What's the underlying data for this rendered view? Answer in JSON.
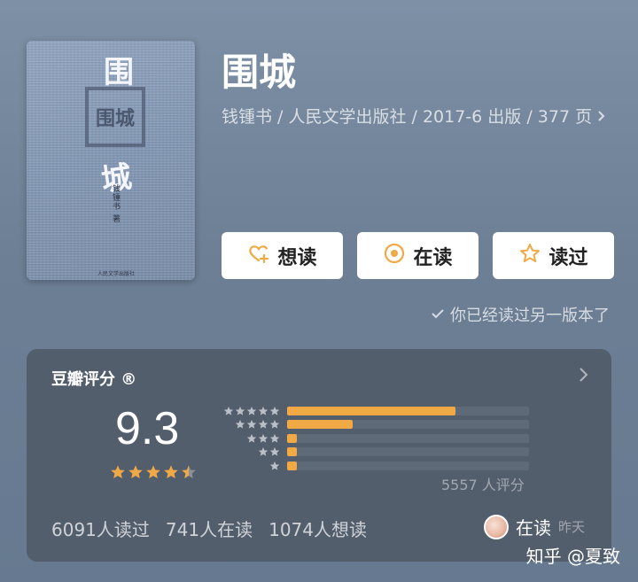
{
  "book": {
    "cover_title_top": "围",
    "cover_title_bottom": "城",
    "cover_seal_text": "围城",
    "cover_author": "钱锺书 著",
    "cover_publisher": "人民文学出版社",
    "title": "围城",
    "meta": "钱锺书 / 人民文学出版社 / 2017-6 出版 / 377 页"
  },
  "actions": [
    {
      "label": "想读",
      "icon": "heart-plus-icon"
    },
    {
      "label": "在读",
      "icon": "reading-circle-icon"
    },
    {
      "label": "读过",
      "icon": "star-outline-icon"
    }
  ],
  "read_note": "你已经读过另一版本了",
  "rating": {
    "header": "豆瓣评分",
    "registered_mark": "®",
    "score": "9.3",
    "stars": 4.5,
    "distribution": [
      {
        "stars": 5,
        "percent": 69.5
      },
      {
        "stars": 4,
        "percent": 27.0
      },
      {
        "stars": 3,
        "percent": 3.0
      },
      {
        "stars": 2,
        "percent": 0.3
      },
      {
        "stars": 1,
        "percent": 0.2
      }
    ],
    "count_text": "5557 人评分",
    "stats": {
      "read": "6091人读过",
      "reading": "741人在读",
      "want": "1074人想读"
    },
    "friend": {
      "status": "在读",
      "time": "昨天"
    }
  },
  "watermark": "知乎 @夏致",
  "colors": {
    "accent": "#f0a945",
    "card": "#535e6d",
    "background": "#75889e"
  }
}
